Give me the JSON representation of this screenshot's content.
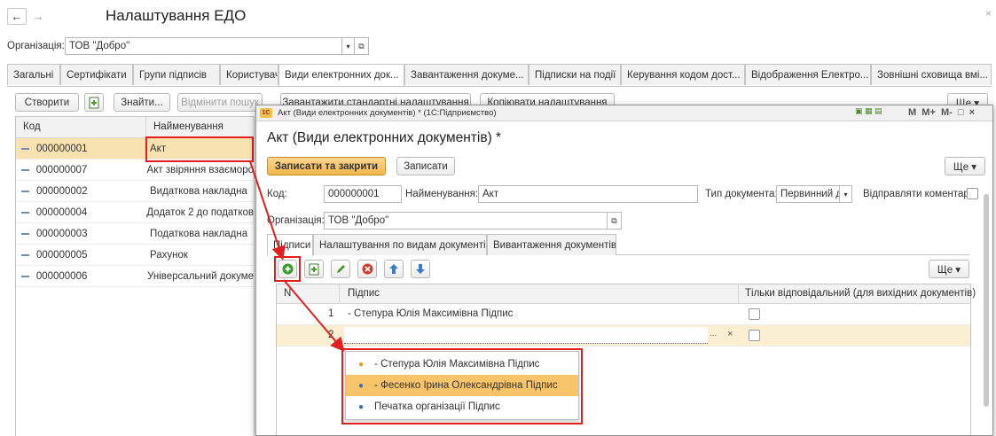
{
  "header": {
    "back": "←",
    "forward": "→",
    "title": "Налаштування ЕДО",
    "close": "×"
  },
  "org": {
    "label": "Організація:",
    "value": "ТОВ \"Добро\""
  },
  "tabs": [
    "Загальні",
    "Сертифікати",
    "Групи підписів",
    "Користувачі",
    "Види електронних док...",
    "Завантаження докуме...",
    "Підписки на події",
    "Керування кодом дост...",
    "Відображення Електро...",
    "Зовнішні сховища вмі..."
  ],
  "toolbar": {
    "create": "Створити",
    "find": "Знайти...",
    "cancel_search": "Відмінити пошук",
    "load_defaults": "Завантажити стандартні налаштування",
    "copy_settings": "Копіювати налаштування",
    "more": "Ще ▾"
  },
  "list": {
    "col_code": "Код",
    "col_name": "Найменування",
    "rows": [
      {
        "code": "000000001",
        "name": "Акт"
      },
      {
        "code": "000000007",
        "name": "Акт звіряння взаєморо"
      },
      {
        "code": "000000002",
        "name": "Видаткова накладна"
      },
      {
        "code": "000000004",
        "name": "Додаток 2 до податков"
      },
      {
        "code": "000000003",
        "name": "Податкова накладна"
      },
      {
        "code": "000000005",
        "name": "Рахунок"
      },
      {
        "code": "000000006",
        "name": "Універсальний докуме"
      }
    ]
  },
  "dialog": {
    "window_title": "Акт (Види електронних документів) * (1С:Підприємство)",
    "window_controls": "M  M+  M-  □  ×",
    "heading": "Акт (Види електронних документів) *",
    "save_close": "Записати та закрити",
    "save": "Записати",
    "more": "Ще ▾",
    "code_label": "Код:",
    "code_value": "000000001",
    "name_label": "Найменування:",
    "name_value": "Акт",
    "doctype_label": "Тип документа:",
    "doctype_value": "Первинний д",
    "send_comment_label": "Відправляти коментар:",
    "org_label": "Організація:",
    "org_value": "ТОВ \"Добро\"",
    "tabs": [
      "Підписи",
      "Налаштування по видам документів",
      "Вивантаження документів"
    ],
    "table": {
      "col_n": "N",
      "col_sign": "Підпис",
      "col_only": "Тільки відповідальний (для вихідних документів)",
      "rows": [
        {
          "n": "1",
          "sign": "- Степура Юлія Максимівна Підпис"
        },
        {
          "n": "2",
          "sign": ""
        }
      ],
      "dropdown_btn": "...",
      "clear_btn": "×"
    },
    "dropdown": [
      "- Степура Юлія Максимівна Підпис",
      "- Фесенко Ірина Олександрівна Підпис",
      "Печатка організації Підпис"
    ]
  }
}
